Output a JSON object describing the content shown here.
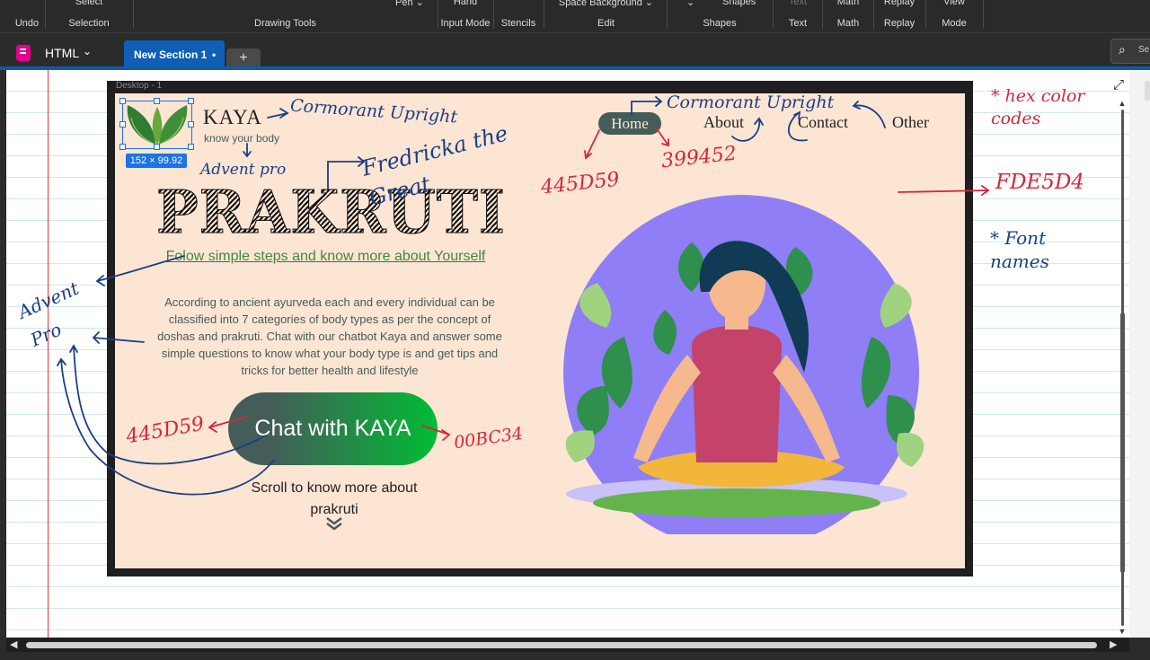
{
  "ribbon": {
    "groups": [
      {
        "label": "Undo",
        "top": ""
      },
      {
        "label": "Selection",
        "top": "Select"
      },
      {
        "label": "Drawing Tools",
        "top": "Pen"
      },
      {
        "label": "Input Mode",
        "top": "Hand"
      },
      {
        "label": "Stencils",
        "top": ""
      },
      {
        "label": "Edit",
        "top": "Space  Background"
      },
      {
        "label": "Shapes",
        "top": "Shapes"
      },
      {
        "label": "Text",
        "top": "Text"
      },
      {
        "label": "Math",
        "top": "Math"
      },
      {
        "label": "Replay",
        "top": "Replay"
      },
      {
        "label": "Mode",
        "top": "View"
      }
    ]
  },
  "tabbar": {
    "notebook_name": "HTML",
    "active_tab": "New Section 1",
    "active_tab_dot": "•",
    "add_tab": "+",
    "search_placeholder": "Se"
  },
  "mockup": {
    "frame_label": "Desktop - 1",
    "selection_size": "152 × 99.92",
    "brand_name": "KAYA",
    "tagline": "know your body",
    "nav": {
      "home": "Home",
      "about": "About",
      "contact": "Contact",
      "other": "Other"
    },
    "hero_title": "PRAKRUTI",
    "subtitle": "Folow simple steps and know more about Yourself",
    "description": "According to ancient ayurveda each and every individual can be classified into 7 categories of body types as per the concept of doshas and prakruti. Chat with our chatbot Kaya and answer some simple questions to know what your body type is and get tips and tricks for better health and lifestyle",
    "cta": "Chat with KAYA",
    "scroll_note": "Scroll to know more about prakruti",
    "scroll_chevron": "⌄",
    "colors": {
      "background": "#FDE5D4",
      "accent": "#445D59",
      "nav_hover": "#399452",
      "cta_end": "#00BC34"
    }
  },
  "annotations": {
    "font_brand": "Cormorant Upright",
    "font_title": "Fredricka the Great",
    "font_tagline": "Advent pro",
    "font_nav": "Cormorant Upright",
    "font_left": "Advent Pro",
    "color_home": "445D59",
    "color_hover": "399452",
    "color_bg": "FDE5D4",
    "color_cta_start": "445D59",
    "color_cta_end": "00BC34",
    "note_hex": "* hex color codes",
    "note_fonts": "* Font names"
  },
  "icons": [
    "notebook-icon",
    "chevron-down-icon",
    "search-icon",
    "expand-icon",
    "leaf-logo-icon",
    "double-chevron-down-icon"
  ]
}
